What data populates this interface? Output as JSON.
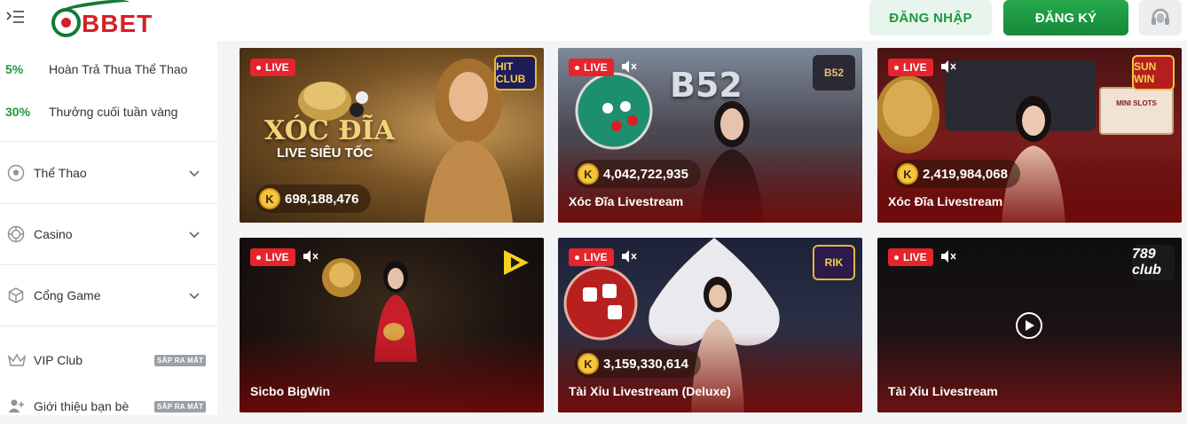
{
  "header": {
    "logo_text": "BBET",
    "login_label": "ĐĂNG NHẬP",
    "register_label": "ĐĂNG KÝ"
  },
  "sidebar": {
    "promos": [
      {
        "percent": "5%",
        "label": "Hoàn Trả Thua Thể Thao"
      },
      {
        "percent": "30%",
        "label": "Thưởng cuối tuần vàng"
      }
    ],
    "items": [
      {
        "label": "Thể Thao",
        "icon": "soccer-ball-icon"
      },
      {
        "label": "Casino",
        "icon": "casino-chip-icon"
      },
      {
        "label": "Cổng Game",
        "icon": "cube-icon"
      },
      {
        "label": "VIP Club",
        "icon": "crown-icon",
        "badge": "SẮP RA MẮT"
      },
      {
        "label": "Giới thiệu bạn bè",
        "icon": "add-user-icon",
        "badge": "SẮP RA MẮT"
      }
    ]
  },
  "cards": [
    {
      "live": "LIVE",
      "art_text_1": "XÓC ĐĨA",
      "art_text_2": "LIVE SIÊU TỐC",
      "jackpot": "698,188,476",
      "title": "",
      "provider": "HIT CLUB"
    },
    {
      "live": "LIVE",
      "art_text_1": "B52",
      "jackpot": "4,042,722,935",
      "title": "Xóc Đĩa Livestream",
      "provider": "B52"
    },
    {
      "live": "LIVE",
      "art_text_1": "MINI SLOTS",
      "jackpot": "2,419,984,068",
      "title": "Xóc Đĩa Livestream",
      "provider": "SUN WIN"
    },
    {
      "live": "LIVE",
      "jackpot": "",
      "title": "Sicbo BigWin",
      "provider": ""
    },
    {
      "live": "LIVE",
      "jackpot": "3,159,330,614",
      "title": "Tài Xỉu Livestream (Deluxe)",
      "provider": "RIK"
    },
    {
      "live": "LIVE",
      "jackpot": "",
      "title": "Tài Xỉu Livestream",
      "provider": "789 club"
    }
  ],
  "jackpot_coin_letter": "K",
  "colors": {
    "brand_green": "#1b9a3f",
    "live_red": "#e5242b",
    "logo_red": "#d61f26"
  }
}
